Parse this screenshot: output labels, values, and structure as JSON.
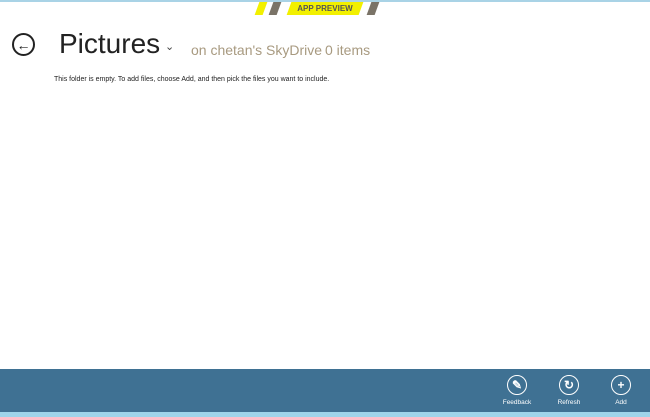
{
  "banner": {
    "label": "APP PREVIEW"
  },
  "header": {
    "title": "Pictures",
    "location": "on chetan's SkyDrive",
    "count": "0 items"
  },
  "main": {
    "empty_message": "This folder is empty. To add files, choose Add, and then pick the files you want to include."
  },
  "appbar": {
    "commands": [
      {
        "label": "Feedback",
        "icon": "feedback-icon"
      },
      {
        "label": "Refresh",
        "icon": "refresh-icon"
      },
      {
        "label": "Add",
        "icon": "plus-icon"
      }
    ]
  },
  "colors": {
    "appbar": "#3f7193",
    "banner": "#f2f000"
  }
}
